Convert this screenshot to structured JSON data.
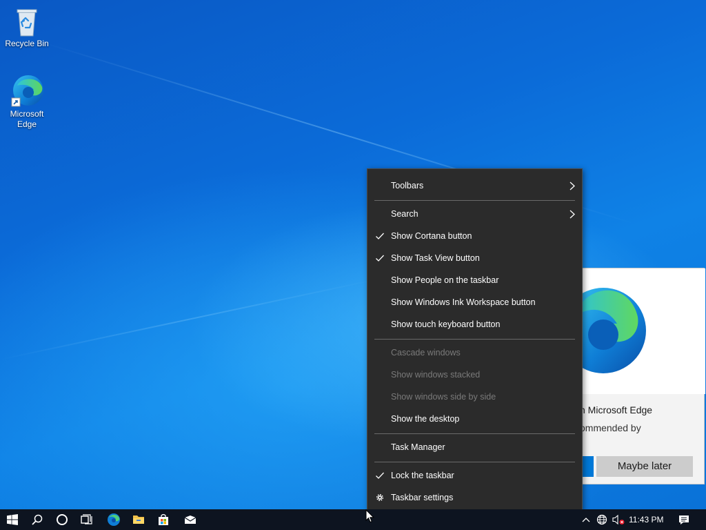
{
  "desktop": {
    "icons": [
      {
        "name": "recycle-bin",
        "label": "Recycle Bin",
        "icon": "recycle-bin-icon"
      },
      {
        "name": "edge",
        "label": "Microsoft Edge",
        "icon": "edge-icon"
      }
    ]
  },
  "edge_promo": {
    "title_visible": "n Microsoft Edge",
    "subtitle_visible": "ommended by",
    "primary_button": "",
    "later_button": "Maybe later"
  },
  "context_menu": {
    "items": [
      {
        "label": "Toolbars",
        "submenu": true
      },
      {
        "label": "Search",
        "submenu": true
      },
      {
        "label": "Show Cortana button",
        "checked": true
      },
      {
        "label": "Show Task View button",
        "checked": true
      },
      {
        "label": "Show People on the taskbar"
      },
      {
        "label": "Show Windows Ink Workspace button"
      },
      {
        "label": "Show touch keyboard button"
      },
      {
        "label": "Cascade windows",
        "disabled": true
      },
      {
        "label": "Show windows stacked",
        "disabled": true
      },
      {
        "label": "Show windows side by side",
        "disabled": true
      },
      {
        "label": "Show the desktop"
      },
      {
        "label": "Task Manager"
      },
      {
        "label": "Lock the taskbar",
        "checked": true
      },
      {
        "label": "Taskbar settings",
        "icon": "gear-icon"
      }
    ]
  },
  "taskbar": {
    "apps": [
      "start-icon",
      "search-icon",
      "cortana-icon",
      "task-view-icon",
      "edge-icon",
      "file-explorer-icon",
      "store-icon",
      "mail-icon"
    ],
    "tray": [
      "chevron-up-icon",
      "network-icon",
      "volume-muted-icon"
    ],
    "clock": "11:43 PM",
    "action_center": "notification-icon"
  },
  "colors": {
    "menu_bg": "#2b2b2b",
    "menu_text": "#ffffff",
    "menu_disabled": "#7a7a7a",
    "taskbar_bg": "#0d1420",
    "accent": "#0078d7"
  }
}
